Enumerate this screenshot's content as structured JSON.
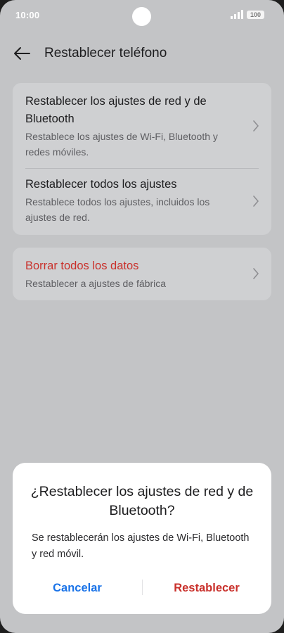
{
  "status_bar": {
    "time": "10:00",
    "battery": "100"
  },
  "header": {
    "back_icon": "arrow-left-icon",
    "title": "Restablecer teléfono"
  },
  "reset_options": [
    {
      "title": "Restablecer los ajustes de red y de Bluetooth",
      "subtitle": "Restablece los ajustes de Wi-Fi, Bluetooth y redes móviles."
    },
    {
      "title": "Restablecer todos los ajustes",
      "subtitle": "Restablece todos los ajustes, incluidos los ajustes de red."
    }
  ],
  "erase": {
    "title": "Borrar todos los datos",
    "subtitle": "Restablecer a ajustes de fábrica"
  },
  "dialog": {
    "title": "¿Restablecer los ajustes de red y de Bluetooth?",
    "message": "Se restablecerán los ajustes de Wi-Fi, Bluetooth y red móvil.",
    "cancel_label": "Cancelar",
    "confirm_label": "Restablecer"
  },
  "colors": {
    "screen_dim": "#c3c4c6",
    "accent_blue": "#1a73e8",
    "danger_red": "#c9302b"
  }
}
